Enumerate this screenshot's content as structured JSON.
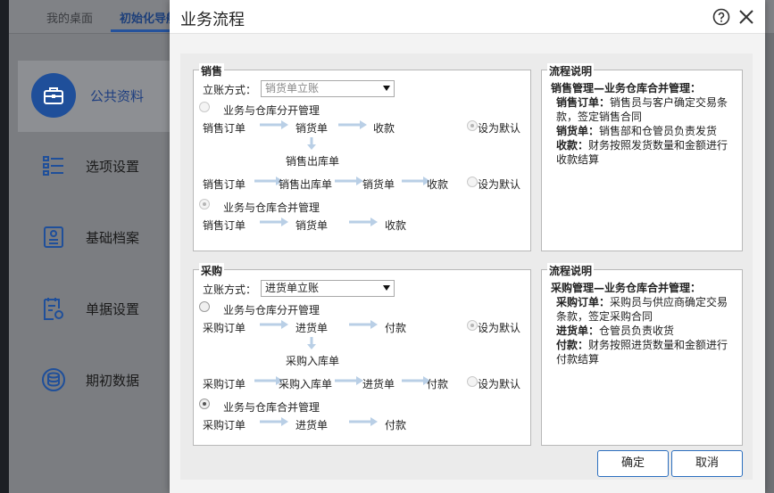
{
  "background": {
    "tabs": [
      "我的桌面",
      "初始化导航"
    ],
    "menu": [
      "公共资料",
      "选项设置",
      "基础档案",
      "单据设置",
      "期初数据"
    ]
  },
  "dialog": {
    "title": "业务流程",
    "sales": {
      "legend": "销售",
      "mode_label": "立账方式：",
      "mode_value": "销货单立账",
      "separate_label": "业务与仓库分开管理",
      "merged_label": "业务与仓库合并管理",
      "flow1": [
        "销售订单",
        "销货单",
        "收款"
      ],
      "flow1_sub": "销售出库单",
      "flow2": [
        "销售订单",
        "销售出库单",
        "销货单",
        "收款"
      ],
      "flow3": [
        "销售订单",
        "销货单",
        "收款"
      ],
      "default_label": "设为默认"
    },
    "sales_desc": {
      "legend": "流程说明",
      "heading": "销售管理—业务仓库合并管理：",
      "items": [
        {
          "term": "销售订单：",
          "text": "销售员与客户确定交易条款，签定销售合同"
        },
        {
          "term": "销货单：",
          "text": "销售部和仓管员负责发货"
        },
        {
          "term": "收款：",
          "text": "财务按照发货数量和金额进行收款结算"
        }
      ]
    },
    "purchase": {
      "legend": "采购",
      "mode_label": "立账方式：",
      "mode_value": "进货单立账",
      "separate_label": "业务与仓库分开管理",
      "merged_label": "业务与仓库合并管理",
      "flow1": [
        "采购订单",
        "进货单",
        "付款"
      ],
      "flow1_sub": "采购入库单",
      "flow2": [
        "采购订单",
        "采购入库单",
        "进货单",
        "付款"
      ],
      "flow3": [
        "采购订单",
        "进货单",
        "付款"
      ],
      "default_label": "设为默认"
    },
    "purchase_desc": {
      "legend": "流程说明",
      "heading": "采购管理—业务仓库合并管理：",
      "items": [
        {
          "term": "采购订单：",
          "text": "采购员与供应商确定交易条款，签定采购合同"
        },
        {
          "term": "进货单：",
          "text": "仓管员负责收货"
        },
        {
          "term": "付款：",
          "text": "财务按照进货数量和金额进行付款结算"
        }
      ]
    },
    "buttons": {
      "ok": "确定",
      "cancel": "取消"
    }
  }
}
